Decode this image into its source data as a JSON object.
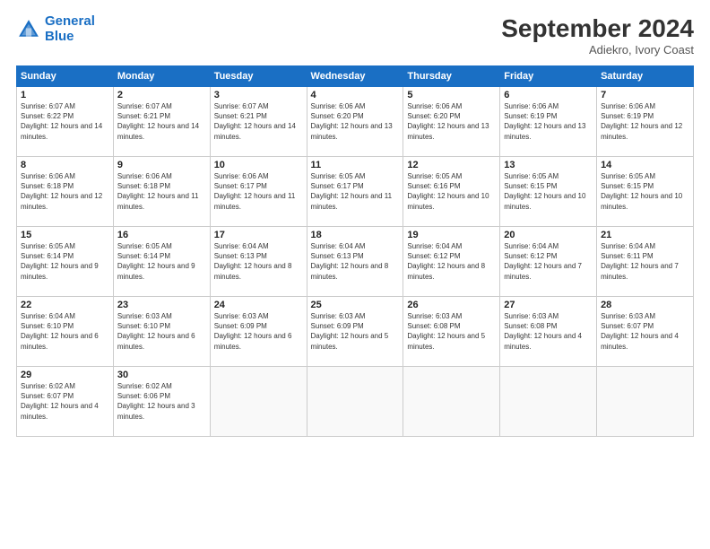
{
  "header": {
    "logo_line1": "General",
    "logo_line2": "Blue",
    "month_title": "September 2024",
    "subtitle": "Adiekro, Ivory Coast"
  },
  "weekdays": [
    "Sunday",
    "Monday",
    "Tuesday",
    "Wednesday",
    "Thursday",
    "Friday",
    "Saturday"
  ],
  "weeks": [
    [
      {
        "day": "1",
        "sunrise": "6:07 AM",
        "sunset": "6:22 PM",
        "daylight": "12 hours and 14 minutes."
      },
      {
        "day": "2",
        "sunrise": "6:07 AM",
        "sunset": "6:21 PM",
        "daylight": "12 hours and 14 minutes."
      },
      {
        "day": "3",
        "sunrise": "6:07 AM",
        "sunset": "6:21 PM",
        "daylight": "12 hours and 14 minutes."
      },
      {
        "day": "4",
        "sunrise": "6:06 AM",
        "sunset": "6:20 PM",
        "daylight": "12 hours and 13 minutes."
      },
      {
        "day": "5",
        "sunrise": "6:06 AM",
        "sunset": "6:20 PM",
        "daylight": "12 hours and 13 minutes."
      },
      {
        "day": "6",
        "sunrise": "6:06 AM",
        "sunset": "6:19 PM",
        "daylight": "12 hours and 13 minutes."
      },
      {
        "day": "7",
        "sunrise": "6:06 AM",
        "sunset": "6:19 PM",
        "daylight": "12 hours and 12 minutes."
      }
    ],
    [
      {
        "day": "8",
        "sunrise": "6:06 AM",
        "sunset": "6:18 PM",
        "daylight": "12 hours and 12 minutes."
      },
      {
        "day": "9",
        "sunrise": "6:06 AM",
        "sunset": "6:18 PM",
        "daylight": "12 hours and 11 minutes."
      },
      {
        "day": "10",
        "sunrise": "6:06 AM",
        "sunset": "6:17 PM",
        "daylight": "12 hours and 11 minutes."
      },
      {
        "day": "11",
        "sunrise": "6:05 AM",
        "sunset": "6:17 PM",
        "daylight": "12 hours and 11 minutes."
      },
      {
        "day": "12",
        "sunrise": "6:05 AM",
        "sunset": "6:16 PM",
        "daylight": "12 hours and 10 minutes."
      },
      {
        "day": "13",
        "sunrise": "6:05 AM",
        "sunset": "6:15 PM",
        "daylight": "12 hours and 10 minutes."
      },
      {
        "day": "14",
        "sunrise": "6:05 AM",
        "sunset": "6:15 PM",
        "daylight": "12 hours and 10 minutes."
      }
    ],
    [
      {
        "day": "15",
        "sunrise": "6:05 AM",
        "sunset": "6:14 PM",
        "daylight": "12 hours and 9 minutes."
      },
      {
        "day": "16",
        "sunrise": "6:05 AM",
        "sunset": "6:14 PM",
        "daylight": "12 hours and 9 minutes."
      },
      {
        "day": "17",
        "sunrise": "6:04 AM",
        "sunset": "6:13 PM",
        "daylight": "12 hours and 8 minutes."
      },
      {
        "day": "18",
        "sunrise": "6:04 AM",
        "sunset": "6:13 PM",
        "daylight": "12 hours and 8 minutes."
      },
      {
        "day": "19",
        "sunrise": "6:04 AM",
        "sunset": "6:12 PM",
        "daylight": "12 hours and 8 minutes."
      },
      {
        "day": "20",
        "sunrise": "6:04 AM",
        "sunset": "6:12 PM",
        "daylight": "12 hours and 7 minutes."
      },
      {
        "day": "21",
        "sunrise": "6:04 AM",
        "sunset": "6:11 PM",
        "daylight": "12 hours and 7 minutes."
      }
    ],
    [
      {
        "day": "22",
        "sunrise": "6:04 AM",
        "sunset": "6:10 PM",
        "daylight": "12 hours and 6 minutes."
      },
      {
        "day": "23",
        "sunrise": "6:03 AM",
        "sunset": "6:10 PM",
        "daylight": "12 hours and 6 minutes."
      },
      {
        "day": "24",
        "sunrise": "6:03 AM",
        "sunset": "6:09 PM",
        "daylight": "12 hours and 6 minutes."
      },
      {
        "day": "25",
        "sunrise": "6:03 AM",
        "sunset": "6:09 PM",
        "daylight": "12 hours and 5 minutes."
      },
      {
        "day": "26",
        "sunrise": "6:03 AM",
        "sunset": "6:08 PM",
        "daylight": "12 hours and 5 minutes."
      },
      {
        "day": "27",
        "sunrise": "6:03 AM",
        "sunset": "6:08 PM",
        "daylight": "12 hours and 4 minutes."
      },
      {
        "day": "28",
        "sunrise": "6:03 AM",
        "sunset": "6:07 PM",
        "daylight": "12 hours and 4 minutes."
      }
    ],
    [
      {
        "day": "29",
        "sunrise": "6:02 AM",
        "sunset": "6:07 PM",
        "daylight": "12 hours and 4 minutes."
      },
      {
        "day": "30",
        "sunrise": "6:02 AM",
        "sunset": "6:06 PM",
        "daylight": "12 hours and 3 minutes."
      },
      {
        "day": "",
        "sunrise": "",
        "sunset": "",
        "daylight": ""
      },
      {
        "day": "",
        "sunrise": "",
        "sunset": "",
        "daylight": ""
      },
      {
        "day": "",
        "sunrise": "",
        "sunset": "",
        "daylight": ""
      },
      {
        "day": "",
        "sunrise": "",
        "sunset": "",
        "daylight": ""
      },
      {
        "day": "",
        "sunrise": "",
        "sunset": "",
        "daylight": ""
      }
    ]
  ]
}
